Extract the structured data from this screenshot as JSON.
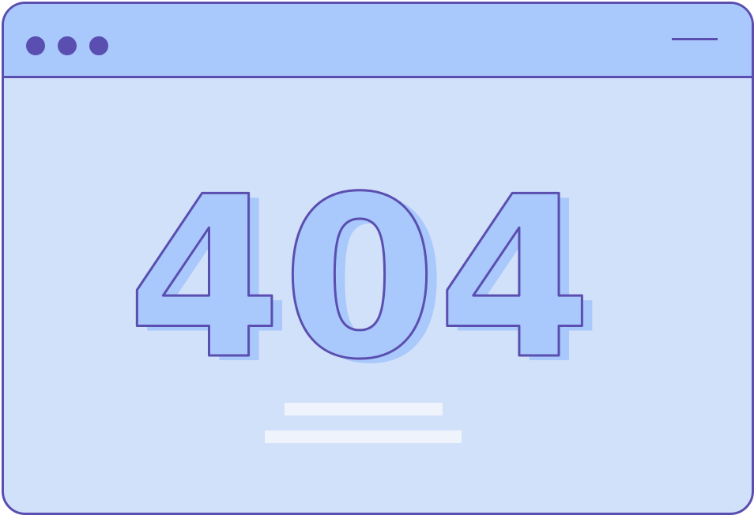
{
  "window": {
    "title_dots": [
      "window-dot",
      "window-dot",
      "window-dot"
    ],
    "minimize_icon": "minimize-icon"
  },
  "error": {
    "code": "404"
  },
  "colors": {
    "outline": "#5a4fb0",
    "titlebar": "#a9c8fb",
    "body": "#d2e1fa",
    "digit_fill": "#a9c8fb",
    "placeholder_line": "#eef3fc"
  }
}
